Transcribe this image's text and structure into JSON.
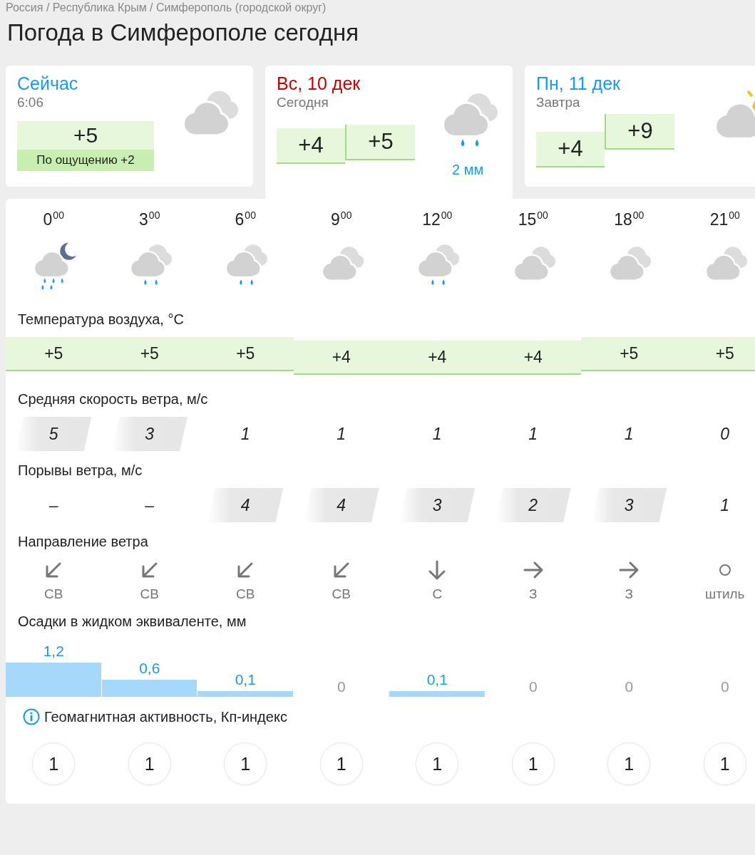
{
  "breadcrumb": "Россия / Республика Крым / Симферополь (городской округ)",
  "title": "Погода в Симферополе сегодня",
  "days": [
    {
      "kind": "now",
      "title": "Сейчас",
      "weekend": false,
      "selected": false,
      "subtitle": "6:06",
      "temperature": "+5",
      "feels_like": "По ощущению +2"
    },
    {
      "kind": "day",
      "title": "Вс, 10 дек",
      "weekend": true,
      "selected": true,
      "subtitle": "Сегодня",
      "temperatures": [
        "+4",
        "+5"
      ],
      "precipitation": "2 мм"
    },
    {
      "kind": "day",
      "title": "Пн, 11 дек",
      "weekend": false,
      "selected": false,
      "subtitle": "Завтра",
      "temperatures": [
        "+4",
        "+9"
      ]
    }
  ],
  "hourly": {
    "hours": [
      {
        "hour": "0",
        "minutes": "00",
        "kind": "night-rain"
      },
      {
        "hour": "3",
        "minutes": "00",
        "kind": "rain"
      },
      {
        "hour": "6",
        "minutes": "00",
        "kind": "rain"
      },
      {
        "hour": "9",
        "minutes": "00",
        "kind": "cloudy"
      },
      {
        "hour": "12",
        "minutes": "00",
        "kind": "rain"
      },
      {
        "hour": "15",
        "minutes": "00",
        "kind": "cloudy"
      },
      {
        "hour": "18",
        "minutes": "00",
        "kind": "cloudy"
      },
      {
        "hour": "21",
        "minutes": "00",
        "kind": "cloudy"
      }
    ],
    "temperature": {
      "label": "Температура воздуха, °C",
      "values": [
        "+5",
        "+5",
        "+5",
        "+4",
        "+4",
        "+4",
        "+5",
        "+5"
      ]
    },
    "wind_speed": {
      "label": "Средняя скорость ветра, м/с",
      "values": [
        {
          "value": "5",
          "highlighted": true
        },
        {
          "value": "3",
          "highlighted": true
        },
        {
          "value": "1",
          "highlighted": false
        },
        {
          "value": "1",
          "highlighted": false
        },
        {
          "value": "1",
          "highlighted": false
        },
        {
          "value": "1",
          "highlighted": false
        },
        {
          "value": "1",
          "highlighted": false
        },
        {
          "value": "0",
          "highlighted": false
        }
      ]
    },
    "gusts": {
      "label": "Порывы ветра, м/с",
      "values": [
        {
          "value": "–",
          "highlighted": false
        },
        {
          "value": "–",
          "highlighted": false
        },
        {
          "value": "4",
          "highlighted": true
        },
        {
          "value": "4",
          "highlighted": true
        },
        {
          "value": "3",
          "highlighted": true
        },
        {
          "value": "2",
          "highlighted": true
        },
        {
          "value": "3",
          "highlighted": true
        },
        {
          "value": "1",
          "highlighted": false
        }
      ]
    },
    "wind_direction": {
      "label": "Направление ветра",
      "values": [
        {
          "kind": "down-left",
          "label": "СВ"
        },
        {
          "kind": "down-left",
          "label": "СВ"
        },
        {
          "kind": "down-left",
          "label": "СВ"
        },
        {
          "kind": "down-left",
          "label": "СВ"
        },
        {
          "kind": "down",
          "label": "С"
        },
        {
          "kind": "right",
          "label": "З"
        },
        {
          "kind": "right",
          "label": "З"
        },
        {
          "kind": "calm",
          "label": "штиль"
        }
      ]
    },
    "precipitation": {
      "label": "Осадки в жидком эквиваленте, мм",
      "values": [
        "1,2",
        "0,6",
        "0,1",
        "0",
        "0,1",
        "0",
        "0",
        "0"
      ]
    },
    "geomagnetic": {
      "label": "Геомагнитная активность, Кп-индекс",
      "values": [
        "1",
        "1",
        "1",
        "1",
        "1",
        "1",
        "1",
        "1"
      ]
    }
  }
}
